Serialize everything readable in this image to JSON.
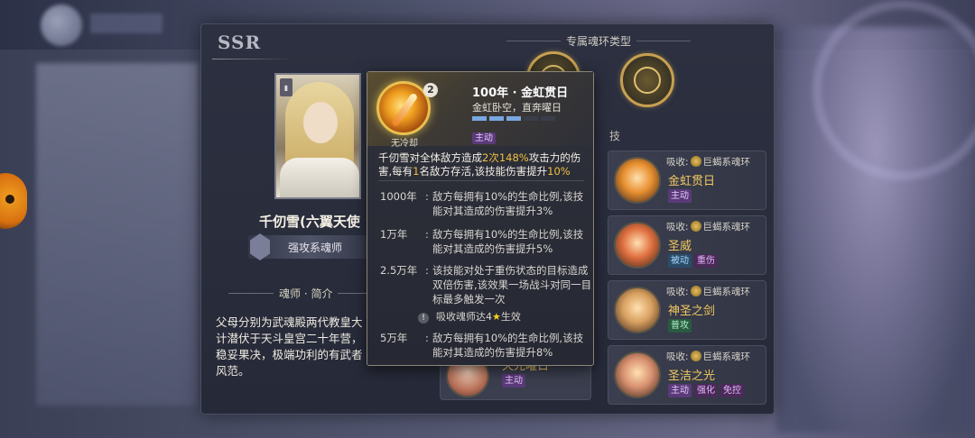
{
  "header": {
    "title": ""
  },
  "panel": {
    "rarity": "SSR",
    "character": {
      "name": "千仞雪(六翼天使",
      "type": "强攻系魂师",
      "intro_title": "魂师 · 简介",
      "intro_text": "父母分别为武魂殿两代教皇大计潜伏于天斗皇宫二十年营，稳妥果决，极端功利的有武者风范。"
    },
    "ring_section_title": "专属魂环类型",
    "skill_section_label": "技",
    "skills_right": [
      {
        "absorb_prefix": "吸收:",
        "absorb_ring": "巨蝎系魂环",
        "name": "金虹贯日",
        "tags": [
          {
            "label": "主动",
            "kind": "active"
          }
        ],
        "icon_color": "#e89030"
      },
      {
        "absorb_prefix": "吸收:",
        "absorb_ring": "巨蝎系魂环",
        "name": "圣威",
        "tags": [
          {
            "label": "被动",
            "kind": "passive"
          },
          {
            "label": "重伤",
            "kind": "heavy"
          }
        ],
        "icon_color": "#e07040"
      },
      {
        "absorb_prefix": "吸收:",
        "absorb_ring": "巨蝎系魂环",
        "name": "神圣之剑",
        "tags": [
          {
            "label": "普攻",
            "kind": "normal"
          }
        ],
        "icon_color": "#d8a060"
      },
      {
        "absorb_prefix": "吸收:",
        "absorb_ring": "巨蝎系魂环",
        "name": "圣洁之光",
        "tags": [
          {
            "label": "主动",
            "kind": "active"
          },
          {
            "label": "强化",
            "kind": "strong"
          },
          {
            "label": "免控",
            "kind": "control"
          }
        ],
        "icon_color": "#d89070"
      }
    ],
    "skill_left": {
      "name": "天光曜日",
      "tag": "主动"
    }
  },
  "tooltip": {
    "badge": "2",
    "cooldown": "无冷却",
    "title": "100年 · 金虹贯日",
    "subtitle": "金虹卧空，直奔曜日",
    "bars_total": 5,
    "bars_on": 3,
    "tag": "主动",
    "main_1": "千仞雪对全体敌方造成",
    "main_hits": "2次",
    "main_pct": "148%",
    "main_2": "攻击力的伤害,每有",
    "main_num": "1",
    "main_3": "名敌方存活,该技能伤害提升",
    "main_bonus": "10%",
    "tiers": [
      {
        "level": "1000年",
        "desc": "敌方每拥有10%的生命比例,该技能对其造成的伤害提升3%"
      },
      {
        "level": "1万年",
        "desc": "敌方每拥有10%的生命比例,该技能对其造成的伤害提升5%"
      },
      {
        "level": "2.5万年",
        "desc": "该技能对处于重伤状态的目标造成双倍伤害,该效果一场战斗对同一目标最多触发一次"
      },
      {
        "level": "5万年",
        "desc": "敌方每拥有10%的生命比例,该技能对其造成的伤害提升8%"
      }
    ],
    "note_warn": "!",
    "note_text": "吸收魂师达4",
    "note_star": "★",
    "note_suffix": "生效"
  }
}
